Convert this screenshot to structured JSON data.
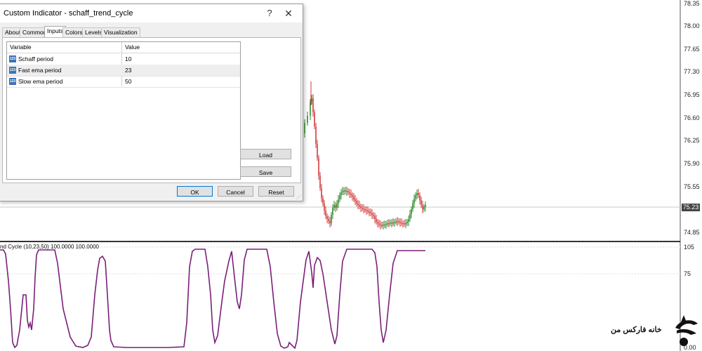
{
  "dialog": {
    "title": "Custom Indicator - schaff_trend_cycle",
    "help_glyph": "?",
    "close_glyph": "✕",
    "tabs": [
      {
        "label": "About",
        "active": false
      },
      {
        "label": "Common",
        "active": false
      },
      {
        "label": "Inputs",
        "active": true
      },
      {
        "label": "Colors",
        "active": false
      },
      {
        "label": "Levels",
        "active": false
      },
      {
        "label": "Visualization",
        "active": false
      }
    ],
    "grid": {
      "columns": [
        "Variable",
        "Value"
      ],
      "row_icon": "123",
      "rows": [
        {
          "variable": "Schaff period",
          "value": "10"
        },
        {
          "variable": "Fast ema period",
          "value": "23"
        },
        {
          "variable": "Slow ema period",
          "value": "50"
        }
      ]
    },
    "buttons": {
      "load": "Load",
      "save": "Save",
      "ok": "OK",
      "cancel": "Cancel",
      "reset": "Reset"
    }
  },
  "chart": {
    "price_ticks": [
      "78.35",
      "78.00",
      "77.65",
      "77.30",
      "76.95",
      "76.60",
      "76.25",
      "75.90",
      "75.55",
      "74.85"
    ],
    "current_price": "75.23",
    "indicator_label": "nd Cycle (10,23,50) 100.0000 100.0000",
    "indicator_ticks": [
      "105",
      "75",
      "0.00"
    ],
    "colors": {
      "bull": "#2a8a2a",
      "bear": "#d23a3a",
      "indicator": "#7a1f7a",
      "grid": "#c8c8c8"
    }
  },
  "branding": {
    "text": "خانه فارکس من"
  }
}
